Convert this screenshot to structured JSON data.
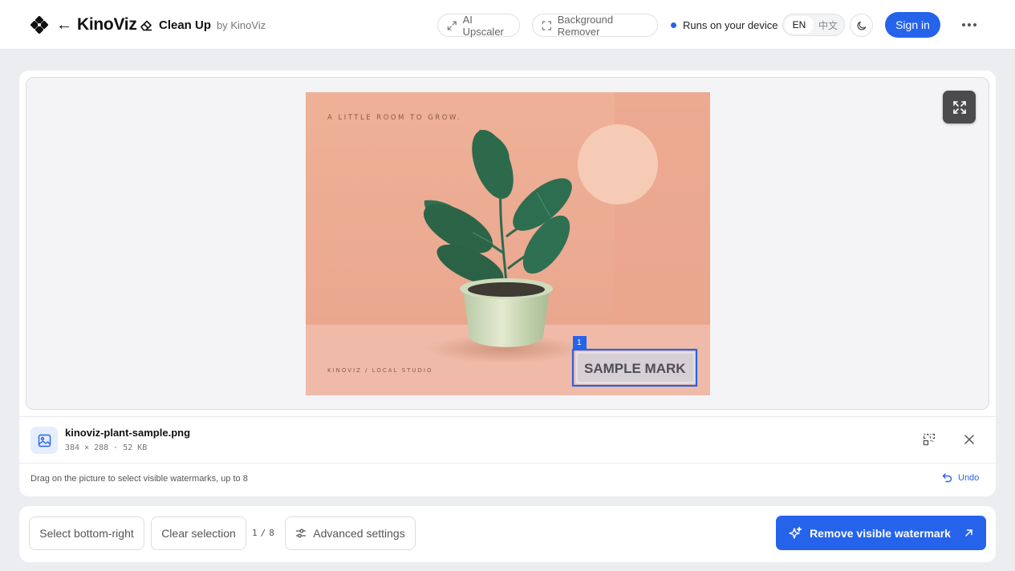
{
  "header": {
    "brand_name": "KinoViz",
    "back_arrow": "←",
    "tool_name": "Clean Up",
    "tool_by": "by KinoViz",
    "ai_upscaler": "AI Upscaler",
    "background_remover": "Background Remover",
    "runs_on_device": "Runs on your device",
    "lang_en": "EN",
    "lang_zh": "中文",
    "sign_in": "Sign in",
    "accent_color": "#2563eb"
  },
  "preview": {
    "tagline": "A LITTLE ROOM TO GROW.",
    "studio_label": "KINOVIZ / LOCAL STUDIO",
    "watermark_text": "SAMPLE MARK",
    "selection_index": "1"
  },
  "file": {
    "name": "kinoviz-plant-sample.png",
    "width": "384",
    "times": "×",
    "height": "288",
    "dot": "·",
    "size": "52 KB"
  },
  "hint": {
    "text": "Drag on the picture to select visible watermarks, up to 8",
    "undo": "Undo"
  },
  "actions": {
    "select_bottom_right": "Select bottom-right",
    "clear_selection": "Clear selection",
    "count_current": "1",
    "count_sep": "/",
    "count_max": "8",
    "advanced_settings": "Advanced settings",
    "remove_watermark": "Remove visible watermark"
  }
}
